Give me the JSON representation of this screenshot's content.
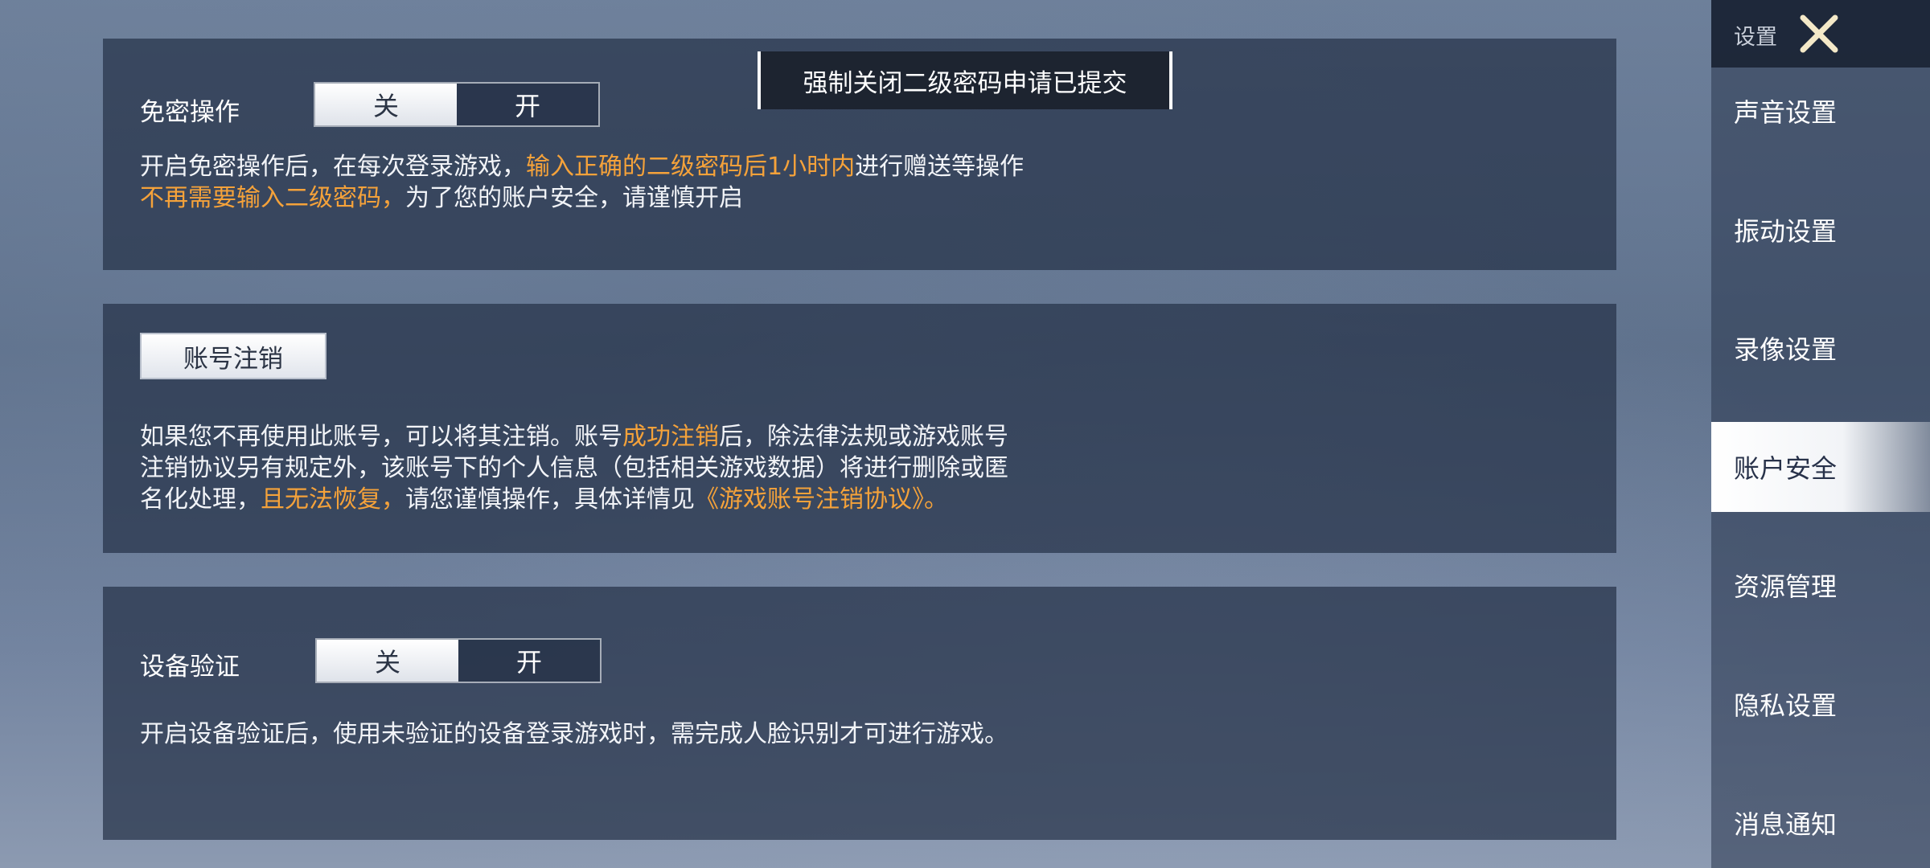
{
  "toast": "强制关闭二级密码申请已提交",
  "sections": {
    "password_free": {
      "label": "免密操作",
      "toggle": {
        "off": "关",
        "on": "开",
        "state": "关"
      },
      "desc_line1_a": "开启免密操作后，在每次登录游戏，",
      "desc_line1_hl": "输入正确的二级密码后1小时内",
      "desc_line1_b": "进行赠送等操作",
      "desc_line2_hl": "不再需要输入二级密码，",
      "desc_line2_b": "为了您的账户安全，请谨慎开启"
    },
    "account_cancel": {
      "button": "账号注销",
      "desc_line1_a": "如果您不再使用此账号，可以将其注销。账号",
      "desc_line1_hl": "成功注销",
      "desc_line1_b": "后，除法律法规或游戏账号",
      "desc_line2": "注销协议另有规定外，该账号下的个人信息（包括相关游戏数据）将进行删除或匿",
      "desc_line3_a": "名化处理，",
      "desc_line3_hl": "且无法恢复，",
      "desc_line3_b": "请您谨慎操作，具体详情见",
      "desc_line3_link": "《游戏账号注销协议》。"
    },
    "device_verify": {
      "label": "设备验证",
      "toggle": {
        "off": "关",
        "on": "开",
        "state": "关"
      },
      "desc": "开启设备验证后，使用未验证的设备登录游戏时，需完成人脸识别才可进行游戏。"
    }
  },
  "sidebar": {
    "title": "设置",
    "items": [
      {
        "label": "声音设置"
      },
      {
        "label": "振动设置"
      },
      {
        "label": "录像设置"
      },
      {
        "label": "账户安全",
        "active": true
      },
      {
        "label": "资源管理"
      },
      {
        "label": "隐私设置"
      },
      {
        "label": "消息通知"
      }
    ]
  },
  "colors": {
    "highlight": "#f5a23a",
    "panel": "#263248"
  }
}
